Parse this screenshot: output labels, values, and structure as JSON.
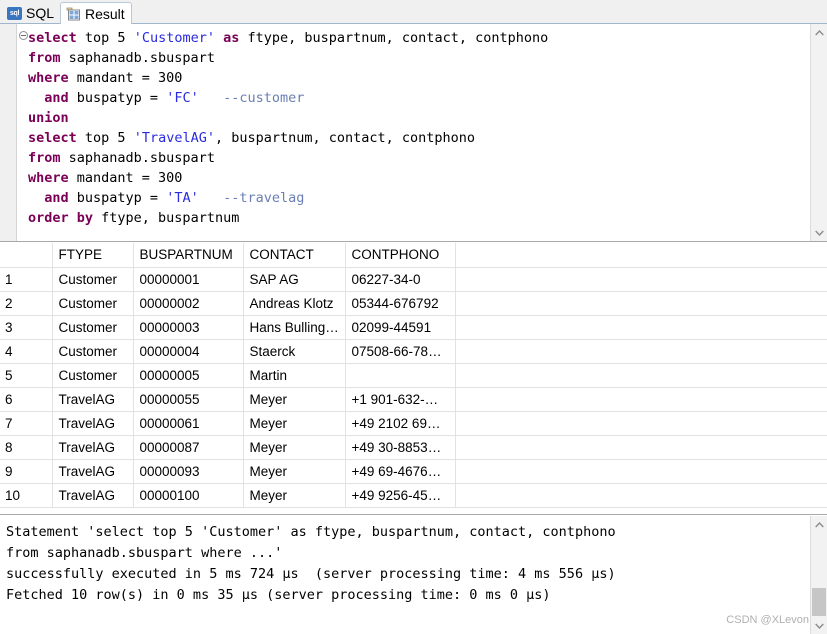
{
  "tabs": [
    {
      "label": "SQL",
      "icon": "sql-badge-icon",
      "active": false
    },
    {
      "label": "Result",
      "icon": "table-grid-icon",
      "active": true
    }
  ],
  "editor": {
    "fold_marker": "collapse-marker",
    "lines": [
      [
        {
          "t": "select",
          "c": "kw"
        },
        {
          "t": " top 5 ",
          "c": ""
        },
        {
          "t": "'Customer'",
          "c": "str"
        },
        {
          "t": " ",
          "c": ""
        },
        {
          "t": "as",
          "c": "kw"
        },
        {
          "t": " ftype, buspartnum, contact, contphono",
          "c": ""
        }
      ],
      [
        {
          "t": "from",
          "c": "kw"
        },
        {
          "t": " saphanadb.sbuspart",
          "c": ""
        }
      ],
      [
        {
          "t": "where",
          "c": "kw"
        },
        {
          "t": " mandant = 300",
          "c": ""
        }
      ],
      [
        {
          "t": "  ",
          "c": ""
        },
        {
          "t": "and",
          "c": "kw"
        },
        {
          "t": " buspatyp = ",
          "c": ""
        },
        {
          "t": "'FC'",
          "c": "str"
        },
        {
          "t": "   ",
          "c": ""
        },
        {
          "t": "--customer",
          "c": "cmt"
        }
      ],
      [
        {
          "t": "union",
          "c": "kw"
        }
      ],
      [
        {
          "t": "select",
          "c": "kw"
        },
        {
          "t": " top 5 ",
          "c": ""
        },
        {
          "t": "'TravelAG'",
          "c": "str"
        },
        {
          "t": ", buspartnum, contact, contphono",
          "c": ""
        }
      ],
      [
        {
          "t": "from",
          "c": "kw"
        },
        {
          "t": " saphanadb.sbuspart",
          "c": ""
        }
      ],
      [
        {
          "t": "where",
          "c": "kw"
        },
        {
          "t": " mandant = 300",
          "c": ""
        }
      ],
      [
        {
          "t": "  ",
          "c": ""
        },
        {
          "t": "and",
          "c": "kw"
        },
        {
          "t": " buspatyp = ",
          "c": ""
        },
        {
          "t": "'TA'",
          "c": "str"
        },
        {
          "t": "   ",
          "c": ""
        },
        {
          "t": "--travelag",
          "c": "cmt"
        }
      ],
      [
        {
          "t": "order by",
          "c": "kw"
        },
        {
          "t": " ftype, buspartnum",
          "c": ""
        }
      ]
    ],
    "scrollbar": {
      "up_arrow": "^",
      "down_arrow": "v"
    }
  },
  "result_grid": {
    "columns": [
      "",
      "FTYPE",
      "BUSPARTNUM",
      "CONTACT",
      "CONTPHONO",
      ""
    ],
    "rows": [
      {
        "num": "1",
        "ftype": "Customer",
        "buspartnum": "00000001",
        "contact": "SAP AG",
        "contphono": "06227-34-0"
      },
      {
        "num": "2",
        "ftype": "Customer",
        "buspartnum": "00000002",
        "contact": "Andreas Klotz",
        "contphono": "05344-676792"
      },
      {
        "num": "3",
        "ftype": "Customer",
        "buspartnum": "00000003",
        "contact": "Hans Bulling…",
        "contphono": "02099-44591"
      },
      {
        "num": "4",
        "ftype": "Customer",
        "buspartnum": "00000004",
        "contact": "Staerck",
        "contphono": "07508-66-78…"
      },
      {
        "num": "5",
        "ftype": "Customer",
        "buspartnum": "00000005",
        "contact": "Martin",
        "contphono": ""
      },
      {
        "num": "6",
        "ftype": "TravelAG",
        "buspartnum": "00000055",
        "contact": "Meyer",
        "contphono": "+1 901-632-…"
      },
      {
        "num": "7",
        "ftype": "TravelAG",
        "buspartnum": "00000061",
        "contact": "Meyer",
        "contphono": "+49 2102 69…"
      },
      {
        "num": "8",
        "ftype": "TravelAG",
        "buspartnum": "00000087",
        "contact": "Meyer",
        "contphono": "+49 30-8853…"
      },
      {
        "num": "9",
        "ftype": "TravelAG",
        "buspartnum": "00000093",
        "contact": "Meyer",
        "contphono": "+49 69-4676…"
      },
      {
        "num": "10",
        "ftype": "TravelAG",
        "buspartnum": "00000100",
        "contact": "Meyer",
        "contphono": "+49 9256-45…"
      }
    ]
  },
  "messages": {
    "text": "Statement 'select top 5 'Customer' as ftype, buspartnum, contact, contphono\nfrom saphanadb.sbuspart where ...'\nsuccessfully executed in 5 ms 724 µs  (server processing time: 4 ms 556 µs)\nFetched 10 row(s) in 0 ms 35 µs (server processing time: 0 ms 0 µs)",
    "scrollbar": {
      "up_arrow": "^",
      "down_arrow": "v"
    }
  },
  "watermark": "CSDN @XLevon",
  "colors": {
    "keyword": "#7a0055",
    "string": "#2a2ae0",
    "comment": "#6a7fb5",
    "tab_icon_blue": "#3a76c0",
    "grid_line": "#e2e2e2"
  }
}
